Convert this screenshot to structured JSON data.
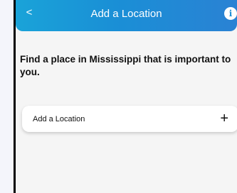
{
  "header": {
    "back_icon": "chevron-left-icon",
    "back_glyph": "<",
    "title": "Add a Location",
    "info_icon": "info-icon",
    "info_glyph": "i",
    "gradient_start": "#1aa3d8",
    "gradient_end": "#2a82d4"
  },
  "main": {
    "prompt": "Find a place in Mississippi that is important to you.",
    "add_location": {
      "label": "Add a Location",
      "plus_icon": "plus-icon",
      "plus_glyph": "+"
    }
  }
}
